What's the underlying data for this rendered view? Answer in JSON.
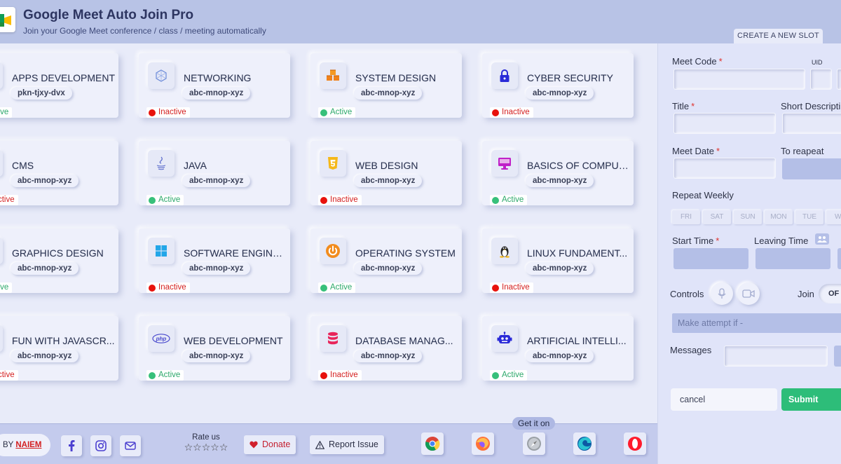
{
  "app": {
    "title": "Google Meet Auto Join Pro",
    "subtitle": "Join your Google Meet conference / class / meeting automatically",
    "create_tab": "CREATE A NEW SLOT"
  },
  "colors": {
    "header_bg": "#b8c3e6",
    "active": "#37c07a",
    "inactive": "#e8120c",
    "submit": "#2dbd79"
  },
  "cards": [
    {
      "title": "APPS DEVELOPMENT",
      "code": "pkn-tjxy-dvx",
      "status": "Active",
      "icon": "apps-icon"
    },
    {
      "title": "NETWORKING",
      "code": "abc-mnop-xyz",
      "status": "Inactive",
      "icon": "network-icon"
    },
    {
      "title": "SYSTEM DESIGN",
      "code": "abc-mnop-xyz",
      "status": "Active",
      "icon": "cubes-icon"
    },
    {
      "title": "CYBER SECURITY",
      "code": "abc-mnop-xyz",
      "status": "Inactive",
      "icon": "lock-icon"
    },
    {
      "title": "CMS",
      "code": "abc-mnop-xyz",
      "status": "Inactive",
      "icon": "cms-icon"
    },
    {
      "title": "JAVA",
      "code": "abc-mnop-xyz",
      "status": "Active",
      "icon": "java-icon"
    },
    {
      "title": "WEB DESIGN",
      "code": "abc-mnop-xyz",
      "status": "Inactive",
      "icon": "html5-icon"
    },
    {
      "title": "BASICS OF COMPUT...",
      "code": "abc-mnop-xyz",
      "status": "Active",
      "icon": "monitor-icon"
    },
    {
      "title": "GRAPHICS DESIGN",
      "code": "abc-mnop-xyz",
      "status": "Active",
      "icon": "graphics-icon"
    },
    {
      "title": "SOFTWARE ENGINE...",
      "code": "abc-mnop-xyz",
      "status": "Inactive",
      "icon": "windows-icon"
    },
    {
      "title": "OPERATING SYSTEM",
      "code": "abc-mnop-xyz",
      "status": "Active",
      "icon": "power-icon"
    },
    {
      "title": "LINUX FUNDAMENT...",
      "code": "abc-mnop-xyz",
      "status": "Inactive",
      "icon": "linux-icon"
    },
    {
      "title": "FUN WITH JAVASCR...",
      "code": "abc-mnop-xyz",
      "status": "Inactive",
      "icon": "javascript-icon"
    },
    {
      "title": "WEB DEVELOPMENT",
      "code": "abc-mnop-xyz",
      "status": "Active",
      "icon": "php-icon"
    },
    {
      "title": "DATABASE MANAG...",
      "code": "abc-mnop-xyz",
      "status": "Inactive",
      "icon": "database-icon"
    },
    {
      "title": "ARTIFICIAL INTELLI...",
      "code": "abc-mnop-xyz",
      "status": "Active",
      "icon": "robot-icon"
    }
  ],
  "form": {
    "meet_code_label": "Meet Code",
    "uid_label": "UID",
    "title_label": "Title",
    "short_desc_label": "Short Descripti",
    "meet_date_label": "Meet Date",
    "repeat_label": "To reapeat",
    "repeat_weekly_label": "Repeat Weekly",
    "days": [
      "FRI",
      "SAT",
      "SUN",
      "MON",
      "TUE",
      "WE"
    ],
    "start_time_label": "Start Time",
    "leaving_time_label": "Leaving Time",
    "controls_label": "Controls",
    "join_label": "Join",
    "join_toggle": "OF",
    "attempt_placeholder": "Make attempt if -",
    "messages_label": "Messages",
    "cancel_label": "cancel",
    "submit_label": "Submit",
    "required_mark": "*"
  },
  "footer": {
    "by": "BY",
    "author": "NAIEM",
    "rate_label": "Rate us",
    "stars": "☆☆☆☆☆",
    "donate": "Donate",
    "report": "Report Issue",
    "get_it_on": "Get it on",
    "browsers": [
      "chrome-icon",
      "firefox-icon",
      "safari-icon",
      "edge-icon",
      "opera-icon"
    ]
  }
}
